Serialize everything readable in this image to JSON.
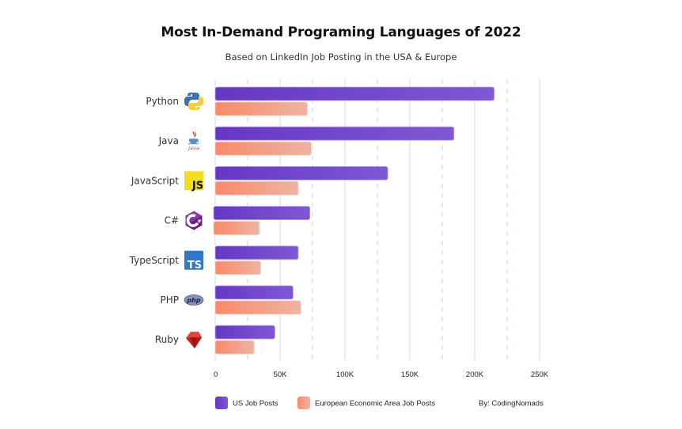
{
  "chart_data": {
    "type": "bar",
    "orientation": "horizontal",
    "title": "Most In-Demand Programing Languages of 2022",
    "subtitle": "Based on LinkedIn Job Posting in the USA & Europe",
    "xlabel": "",
    "ylabel": "",
    "categories": [
      "Python",
      "Java",
      "JavaScript",
      "C#",
      "TypeScript",
      "PHP",
      "Ruby"
    ],
    "category_icons": [
      "python-logo-icon",
      "java-logo-icon",
      "javascript-logo-icon",
      "csharp-logo-icon",
      "typescript-logo-icon",
      "php-logo-icon",
      "ruby-logo-icon"
    ],
    "series": [
      {
        "name": "US Job Posts",
        "color": "#6a3fc8",
        "values": [
          215000,
          184000,
          133000,
          73000,
          64000,
          60000,
          46000
        ]
      },
      {
        "name": "European Economic Area Job Posts",
        "color": "#f79a7a",
        "values": [
          71000,
          74000,
          64000,
          34000,
          35000,
          66000,
          30000
        ]
      }
    ],
    "xlim": [
      0,
      250000
    ],
    "xticks": [
      0,
      50000,
      100000,
      150000,
      200000,
      250000
    ],
    "xtick_labels": [
      "0",
      "50K",
      "100K",
      "150K",
      "200K",
      "250K"
    ],
    "grid": "vertical (solid at major ticks, dashed at midpoints)",
    "legend_position": "bottom",
    "annotation": "By: CodingNomads"
  },
  "colors": {
    "us_bar": "#6a3fc8",
    "us_bar_light": "#7f5ad6",
    "eu_bar": "#f78d6c",
    "eu_bar_light": "#efb6a3",
    "grid": "#cfe0f5"
  }
}
